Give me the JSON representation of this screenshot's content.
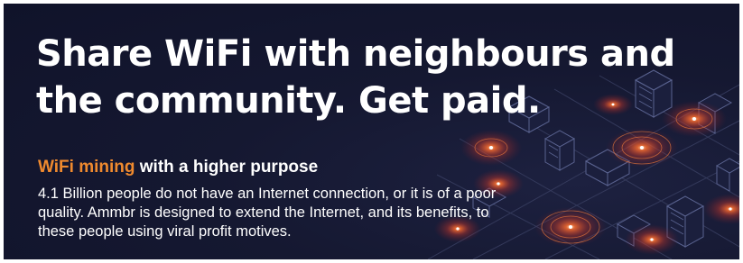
{
  "banner": {
    "headline": {
      "line1": "Share WiFi with neighbours and",
      "line2": "the community. Get paid."
    },
    "subheading": {
      "accent": "WiFi mining",
      "rest": "with a higher purpose"
    },
    "body": {
      "line1": "4.1 Billion people do not have an Internet connection, or it is of a poor",
      "line2": "quality. Ammbr is designed to extend the Internet, and its benefits, to",
      "line3": "these people using viral profit motives."
    },
    "colors": {
      "background": "#151831",
      "accent": "#f08a2e",
      "text": "#ffffff",
      "glow": "#e0452a"
    },
    "illustration": "isometric-city-wifi-hotspots"
  }
}
